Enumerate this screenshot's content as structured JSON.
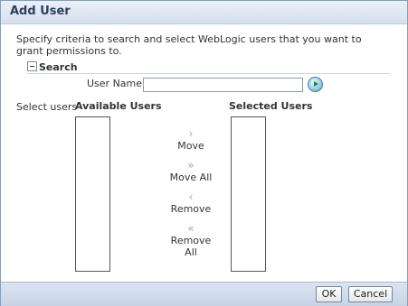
{
  "dialog": {
    "title": "Add User",
    "description": "Specify criteria to search and select WebLogic users that you want to grant permissions to."
  },
  "search": {
    "header": "Search",
    "user_name_label": "User Name",
    "user_name_value": "",
    "user_name_placeholder": ""
  },
  "shuttle": {
    "select_users_label": "Select users",
    "available_header": "Available Users",
    "selected_header": "Selected Users",
    "available_items": [],
    "selected_items": [],
    "move_label": "Move",
    "move_all_label": "Move All",
    "remove_label": "Remove",
    "remove_all_label": "Remove All",
    "move_glyph": "›",
    "move_all_glyph": "»",
    "remove_glyph": "‹",
    "remove_all_glyph": "«"
  },
  "footer": {
    "ok_label": "OK",
    "cancel_label": "Cancel"
  },
  "icons": {
    "collapse": "collapse-icon",
    "go": "go-arrow-icon",
    "move": "chevron-right-icon",
    "move_all": "double-chevron-right-icon",
    "remove": "chevron-left-icon",
    "remove_all": "double-chevron-left-icon"
  },
  "colors": {
    "title_text": "#2f3f58",
    "title_bg": "#d4e0f0",
    "footer_bg": "#c7d3e5",
    "go_button": "#5fa7d7"
  }
}
